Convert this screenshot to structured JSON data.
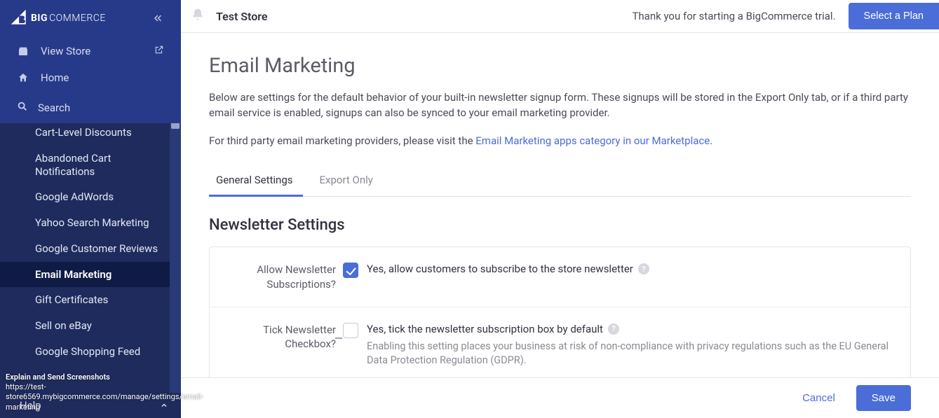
{
  "logo_text": "COMMERCE",
  "sidebar": {
    "view_store": "View Store",
    "home": "Home",
    "search": "Search",
    "items": [
      "Cart-Level Discounts",
      "Abandoned Cart Notifications",
      "Google AdWords",
      "Yahoo Search Marketing",
      "Google Customer Reviews",
      "Email Marketing",
      "Gift Certificates",
      "Sell on eBay",
      "Google Shopping Feed"
    ],
    "help": "Help"
  },
  "tooltip": {
    "line1": "Explain and Send Screenshots",
    "line2": "https://test-store6569.mybigcommerce.com/manage/settings/email-marketing"
  },
  "header": {
    "store_name": "Test Store",
    "trial_msg": "Thank you for starting a BigCommerce trial.",
    "plan_btn": "Select a Plan"
  },
  "page": {
    "title": "Email Marketing",
    "desc1": "Below are settings for the default behavior of your built-in newsletter signup form. These signups will be stored in the Export Only tab, or if a third party email service is enabled, signups can also be synced to your email marketing provider.",
    "desc2_a": "For third party email marketing providers, please visit the ",
    "desc2_link": "Email Marketing apps category in our Marketplace",
    "desc2_b": "."
  },
  "tabs": {
    "general": "General Settings",
    "export": "Export Only"
  },
  "section_title": "Newsletter Settings",
  "field1": {
    "label": "Allow Newsletter Subscriptions?",
    "text": "Yes, allow customers to subscribe to the store newsletter"
  },
  "field2": {
    "label": "Tick Newsletter Checkbox?",
    "text": "Yes, tick the newsletter subscription box by default",
    "hint": "Enabling this setting places your business at risk of non-compliance with privacy regulations such as the EU General Data Protection Regulation (GDPR)."
  },
  "actions": {
    "cancel": "Cancel",
    "save": "Save"
  }
}
